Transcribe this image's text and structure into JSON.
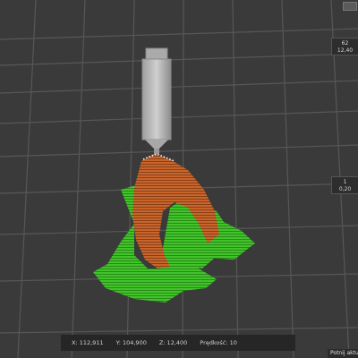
{
  "layer_slider": {
    "top": {
      "layer": "62",
      "height": "12,40"
    },
    "bottom": {
      "layer": "1",
      "height": "0,20"
    }
  },
  "status_bar": {
    "x": "X: 112,911",
    "y": "Y: 104,900",
    "z": "Z: 12,400",
    "speed": "Prędkość: 10"
  },
  "slice_button": {
    "label": "Potnij aktu"
  },
  "colors": {
    "background": "#3a3a3a",
    "grid_line": "#565656",
    "model_orange": "#c8652c",
    "support_green": "#3fbf2a",
    "nozzle": "#bdbdbd"
  },
  "icons": {
    "top_slider_handle": "slider-handle-icon"
  }
}
